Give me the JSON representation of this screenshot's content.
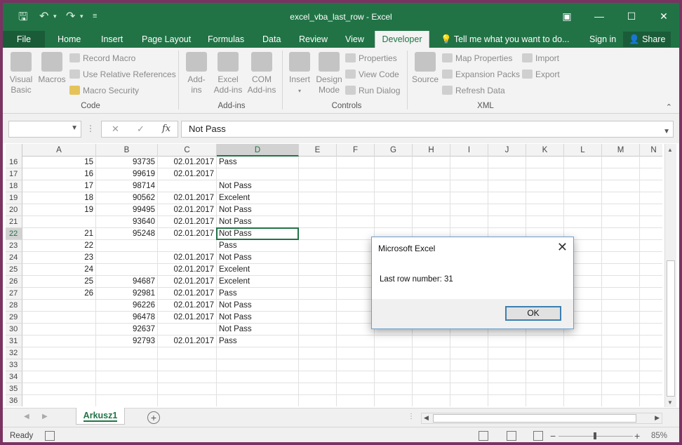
{
  "window": {
    "title": "excel_vba_last_row - Excel",
    "controls": [
      "ribbon-display-icon",
      "minimize-icon",
      "maximize-icon",
      "close-icon"
    ]
  },
  "quick_access": [
    "save-icon",
    "undo-icon",
    "redo-icon",
    "customize-icon"
  ],
  "tabs": {
    "file": "File",
    "home": "Home",
    "insert": "Insert",
    "page_layout": "Page Layout",
    "formulas": "Formulas",
    "data": "Data",
    "review": "Review",
    "view": "View",
    "developer": "Developer",
    "tell_me": "Tell me what you want to do...",
    "sign_in": "Sign in",
    "share": "Share"
  },
  "ribbon": {
    "code": {
      "label": "Code",
      "visual_basic_1": "Visual",
      "visual_basic_2": "Basic",
      "macros": "Macros",
      "record_macro": "Record Macro",
      "use_relative": "Use Relative References",
      "macro_security": "Macro Security"
    },
    "addins": {
      "label": "Add-ins",
      "addins_1": "Add-",
      "addins_2": "ins",
      "excel_addins_1": "Excel",
      "excel_addins_2": "Add-ins",
      "com_addins_1": "COM",
      "com_addins_2": "Add-ins"
    },
    "controls": {
      "label": "Controls",
      "insert": "Insert",
      "design_1": "Design",
      "design_2": "Mode",
      "properties": "Properties",
      "view_code": "View Code",
      "run_dialog": "Run Dialog"
    },
    "xml": {
      "label": "XML",
      "source": "Source",
      "map_properties": "Map Properties",
      "expansion_packs": "Expansion Packs",
      "refresh_data": "Refresh Data",
      "import": "Import",
      "export": "Export"
    }
  },
  "formula_bar": {
    "name_box": "",
    "cancel": "✕",
    "enter": "✓",
    "fx": "fx",
    "value": "Not Pass"
  },
  "columns": [
    "A",
    "B",
    "C",
    "D",
    "E",
    "F",
    "G",
    "H",
    "I",
    "J",
    "K",
    "L",
    "M",
    "N"
  ],
  "rows": [
    {
      "n": "16",
      "a": "15",
      "b": "93735",
      "c": "02.01.2017",
      "d": "Pass"
    },
    {
      "n": "17",
      "a": "16",
      "b": "99619",
      "c": "02.01.2017",
      "d": ""
    },
    {
      "n": "18",
      "a": "17",
      "b": "98714",
      "c": "",
      "d": "Not Pass"
    },
    {
      "n": "19",
      "a": "18",
      "b": "90562",
      "c": "02.01.2017",
      "d": "Excelent"
    },
    {
      "n": "20",
      "a": "19",
      "b": "99495",
      "c": "02.01.2017",
      "d": "Not Pass"
    },
    {
      "n": "21",
      "a": "",
      "b": "93640",
      "c": "02.01.2017",
      "d": "Not Pass"
    },
    {
      "n": "22",
      "a": "21",
      "b": "95248",
      "c": "02.01.2017",
      "d": "Not Pass"
    },
    {
      "n": "23",
      "a": "22",
      "b": "",
      "c": "",
      "d": "Pass"
    },
    {
      "n": "24",
      "a": "23",
      "b": "",
      "c": "02.01.2017",
      "d": "Not Pass"
    },
    {
      "n": "25",
      "a": "24",
      "b": "",
      "c": "02.01.2017",
      "d": "Excelent"
    },
    {
      "n": "26",
      "a": "25",
      "b": "94687",
      "c": "02.01.2017",
      "d": "Excelent"
    },
    {
      "n": "27",
      "a": "26",
      "b": "92981",
      "c": "02.01.2017",
      "d": "Pass"
    },
    {
      "n": "28",
      "a": "",
      "b": "96226",
      "c": "02.01.2017",
      "d": "Not Pass"
    },
    {
      "n": "29",
      "a": "",
      "b": "96478",
      "c": "02.01.2017",
      "d": "Not Pass"
    },
    {
      "n": "30",
      "a": "",
      "b": "92637",
      "c": "",
      "d": "Not Pass"
    },
    {
      "n": "31",
      "a": "",
      "b": "92793",
      "c": "02.01.2017",
      "d": "Pass"
    },
    {
      "n": "32",
      "a": "",
      "b": "",
      "c": "",
      "d": ""
    },
    {
      "n": "33",
      "a": "",
      "b": "",
      "c": "",
      "d": ""
    },
    {
      "n": "34",
      "a": "",
      "b": "",
      "c": "",
      "d": ""
    },
    {
      "n": "35",
      "a": "",
      "b": "",
      "c": "",
      "d": ""
    },
    {
      "n": "36",
      "a": "",
      "b": "",
      "c": "",
      "d": ""
    }
  ],
  "selected": {
    "row": "22",
    "column": "D"
  },
  "sheet_tabs": {
    "active": "Arkusz1"
  },
  "status": {
    "text": "Ready",
    "zoom": "85%"
  },
  "dialog": {
    "title": "Microsoft Excel",
    "message": "Last row number: 31",
    "ok": "OK"
  },
  "colors": {
    "accent": "#217346",
    "dialog_border": "#3c7fb1"
  }
}
